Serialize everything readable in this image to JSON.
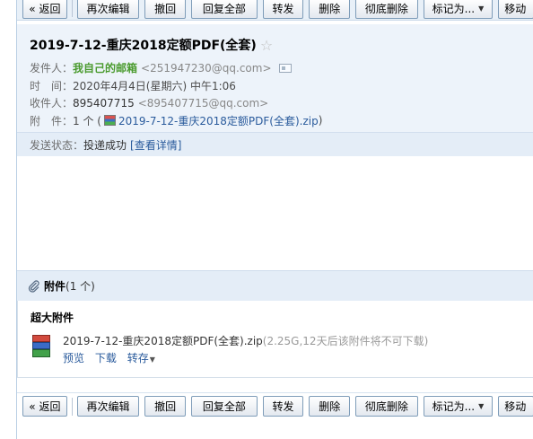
{
  "toolbar": {
    "back": "« 返回",
    "edit_again": "再次编辑",
    "recall": "撤回",
    "reply_all": "回复全部",
    "forward": "转发",
    "delete": "删除",
    "delete_forever": "彻底删除",
    "mark_as": "标记为...",
    "move_to": "移动"
  },
  "email": {
    "subject": "2019-7-12-重庆2018定额PDF(全套)",
    "sender_label": "发件人：",
    "sender_name": "我自己的邮箱",
    "sender_addr": "<251947230@qq.com>",
    "time_label": "时　间：",
    "time_value": "2020年4月4日(星期六) 中午1:06",
    "recipient_label": "收件人：",
    "recipient_name": "895407715",
    "recipient_addr": "<895407715@qq.com>",
    "attach_label": "附　件：",
    "attach_count_prefix": "1 个 (",
    "attach_filename": "2019-7-12-重庆2018定额PDF(全套).zip",
    "attach_count_suffix": ")",
    "status_label": "发送状态：",
    "status_value": "投递成功",
    "status_link": "[查看详情]"
  },
  "attachments": {
    "title": "附件",
    "count": "(1 个)",
    "section_label": "超大附件",
    "file_name": "2019-7-12-重庆2018定额PDF(全套).zip",
    "file_meta": "(2.25G,12天后该附件将不可下载)",
    "preview": "预览",
    "download": "下载",
    "save_to": "转存"
  },
  "colors": {
    "header_bg": "#edf3fa",
    "sender_green": "#4b9b2f",
    "link_blue": "#2a5b9c"
  }
}
